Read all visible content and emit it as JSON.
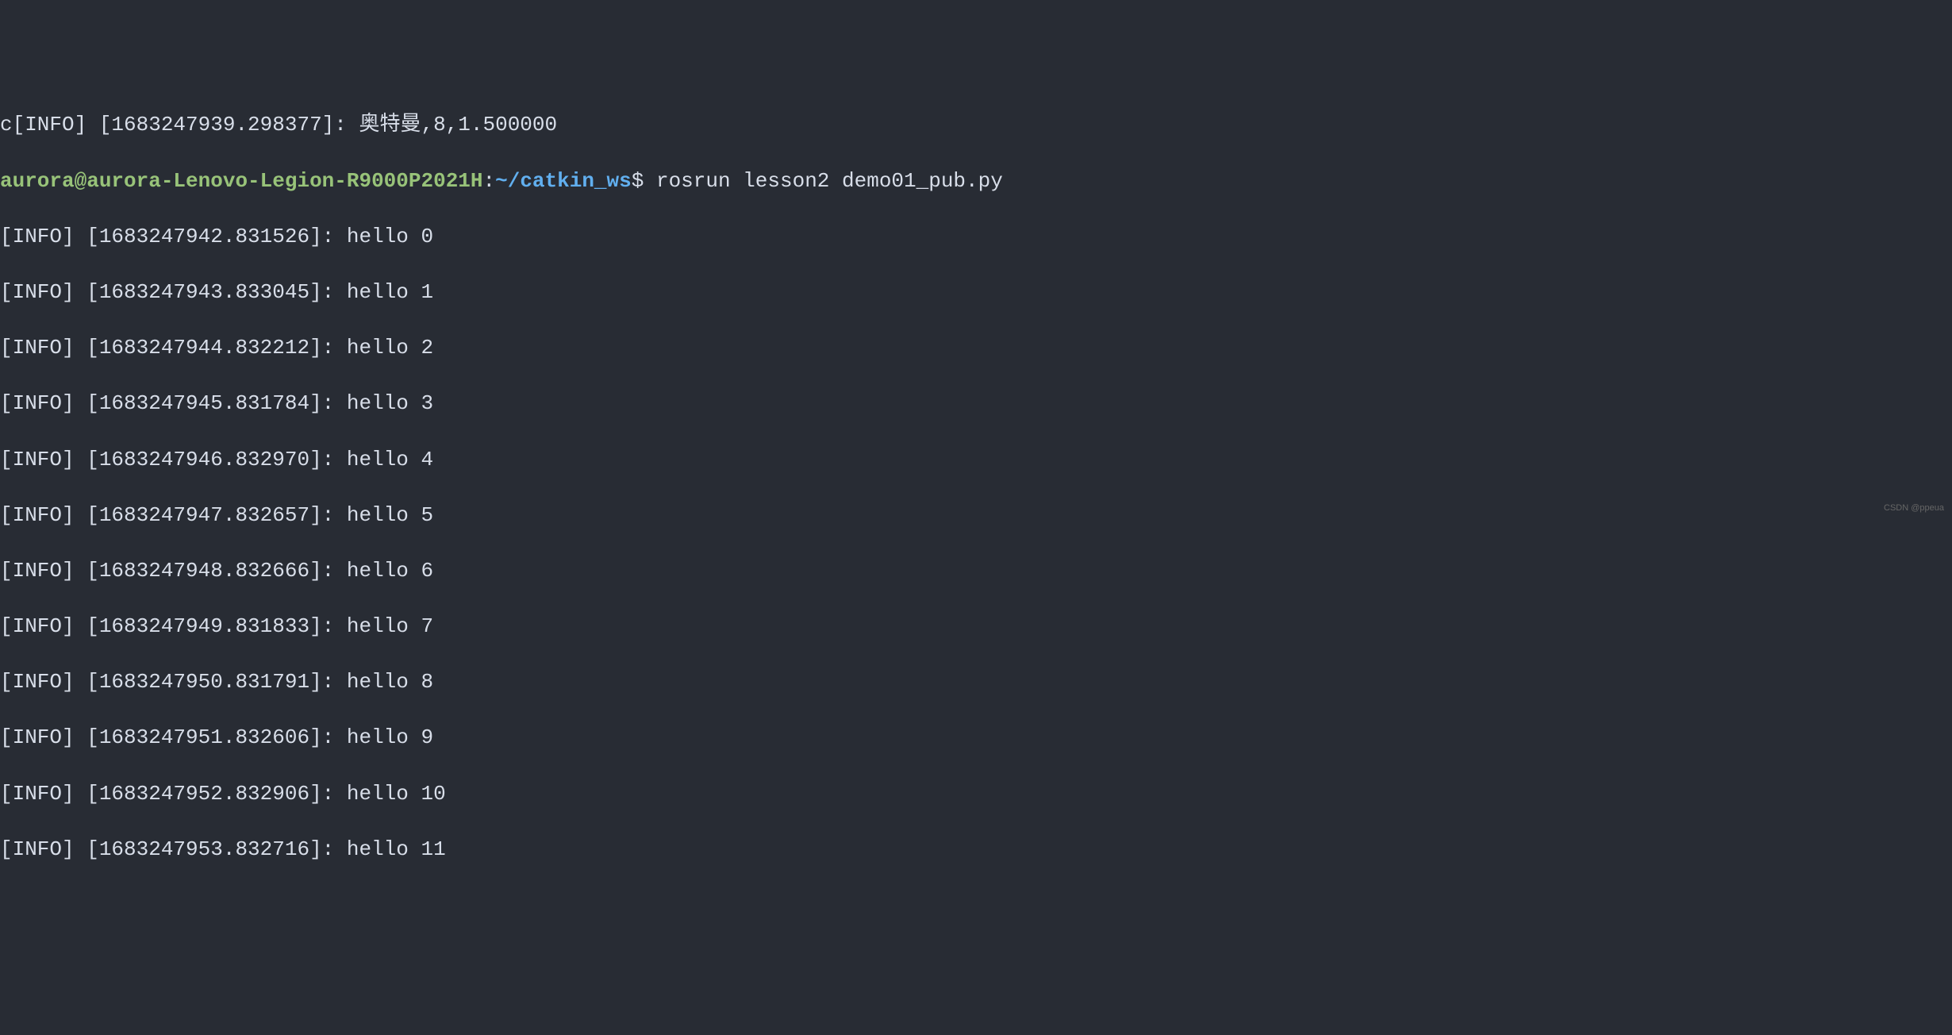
{
  "partial_line": "c[INFO] [1683247939.298377]: 奥特曼,8,1.500000",
  "prompt": {
    "user_host": "aurora@aurora-Lenovo-Legion-R9000P2021H",
    "colon": ":",
    "path": "~/catkin_ws",
    "dollar": "$ ",
    "command": "rosrun lesson2 demo01_pub.py"
  },
  "log_lines": [
    "[INFO] [1683247942.831526]: hello 0",
    "[INFO] [1683247943.833045]: hello 1",
    "[INFO] [1683247944.832212]: hello 2",
    "[INFO] [1683247945.831784]: hello 3",
    "[INFO] [1683247946.832970]: hello 4",
    "[INFO] [1683247947.832657]: hello 5",
    "[INFO] [1683247948.832666]: hello 6",
    "[INFO] [1683247949.831833]: hello 7",
    "[INFO] [1683247950.831791]: hello 8",
    "[INFO] [1683247951.832606]: hello 9",
    "[INFO] [1683247952.832906]: hello 10",
    "[INFO] [1683247953.832716]: hello 11"
  ],
  "watermark": "CSDN @ppeua"
}
